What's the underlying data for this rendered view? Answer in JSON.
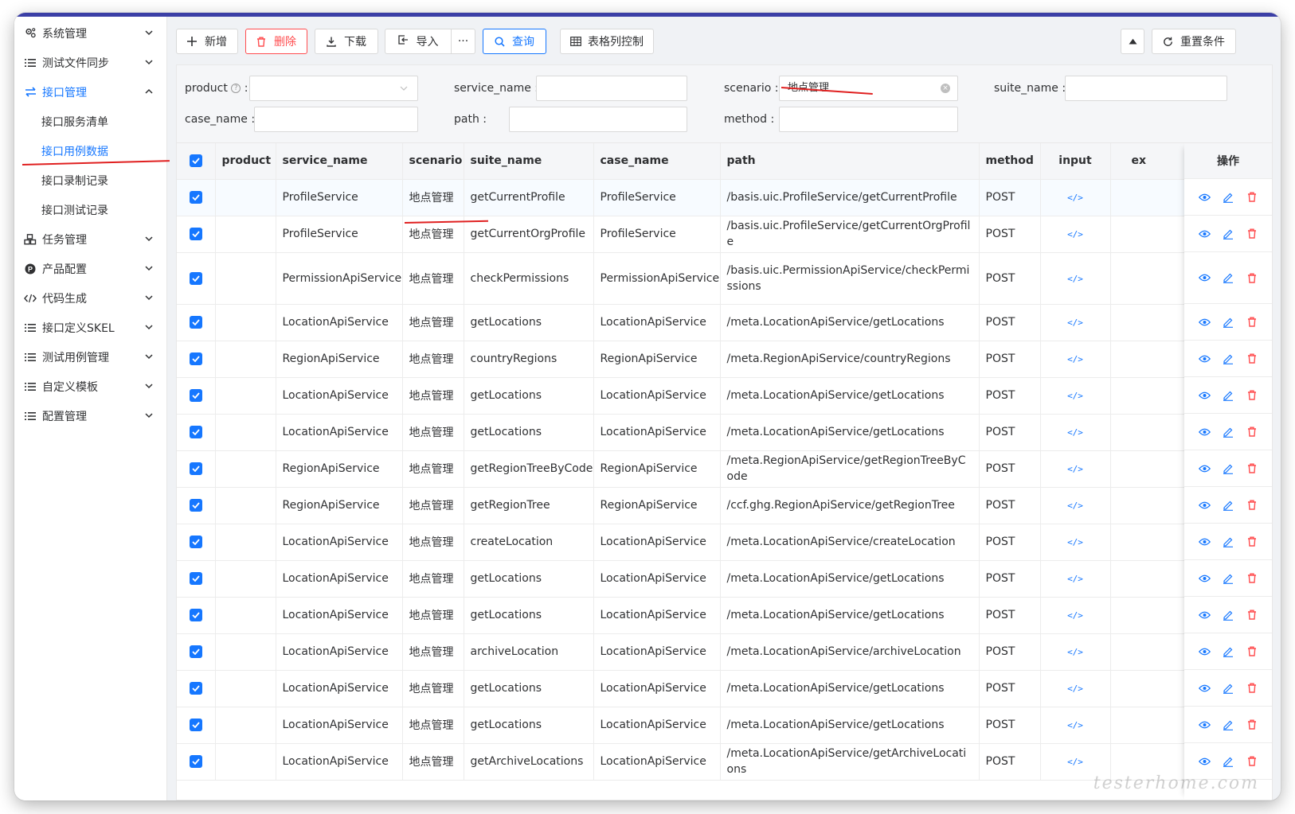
{
  "sidebar": {
    "menus": [
      {
        "label": "系统管理",
        "icon": "gears-icon",
        "expanded": false
      },
      {
        "label": "测试文件同步",
        "icon": "list-icon",
        "expanded": false
      },
      {
        "label": "接口管理",
        "icon": "swap-icon",
        "expanded": true,
        "children": [
          "接口服务清单",
          "接口用例数据",
          "接口录制记录",
          "接口测试记录"
        ],
        "selected_child": "接口用例数据"
      },
      {
        "label": "任务管理",
        "icon": "cubes-icon",
        "expanded": false
      },
      {
        "label": "产品配置",
        "icon": "product-icon",
        "expanded": false
      },
      {
        "label": "代码生成",
        "icon": "code-icon",
        "expanded": false
      },
      {
        "label": "接口定义SKEL",
        "icon": "list-icon",
        "expanded": false
      },
      {
        "label": "测试用例管理",
        "icon": "list-icon",
        "expanded": false
      },
      {
        "label": "自定义模板",
        "icon": "list-icon",
        "expanded": false
      },
      {
        "label": "配置管理",
        "icon": "list-icon",
        "expanded": false
      }
    ]
  },
  "toolbar": {
    "add_label": "新增",
    "delete_label": "删除",
    "download_label": "下载",
    "import_label": "导入",
    "more_label": "···",
    "query_label": "查询",
    "column_control_label": "表格列控制",
    "reset_label": "重置条件"
  },
  "filters": {
    "product_label": "product",
    "product_colon": ":",
    "service_name_label": "service_name :",
    "scenario_label": "scenario :",
    "scenario_value": "地点管理",
    "suite_name_label": "suite_name :",
    "case_name_label": "case_name :",
    "path_label": "path :",
    "method_label": "method :"
  },
  "table": {
    "columns": [
      "product",
      "service_name",
      "scenario",
      "suite_name",
      "case_name",
      "path",
      "method",
      "input",
      "ex"
    ],
    "ops_header": "操作",
    "rows": [
      {
        "product": "",
        "service_name": "ProfileService",
        "scenario": "地点管理",
        "suite_name": "getCurrentProfile",
        "case_name": "ProfileService",
        "path": "/basis.uic.ProfileService/getCurrentProfile",
        "method": "POST"
      },
      {
        "product": "",
        "service_name": "ProfileService",
        "scenario": "地点管理",
        "suite_name": "getCurrentOrgProfile",
        "case_name": "ProfileService",
        "path": "/basis.uic.ProfileService/getCurrentOrgProfile",
        "method": "POST"
      },
      {
        "product": "",
        "service_name": "PermissionApiService",
        "scenario": "地点管理",
        "suite_name": "checkPermissions",
        "case_name": "PermissionApiService",
        "path": "/basis.uic.PermissionApiService/checkPermissions",
        "method": "POST"
      },
      {
        "product": "",
        "service_name": "LocationApiService",
        "scenario": "地点管理",
        "suite_name": "getLocations",
        "case_name": "LocationApiService",
        "path": "/meta.LocationApiService/getLocations",
        "method": "POST"
      },
      {
        "product": "",
        "service_name": "RegionApiService",
        "scenario": "地点管理",
        "suite_name": "countryRegions",
        "case_name": "RegionApiService",
        "path": "/meta.RegionApiService/countryRegions",
        "method": "POST"
      },
      {
        "product": "",
        "service_name": "LocationApiService",
        "scenario": "地点管理",
        "suite_name": "getLocations",
        "case_name": "LocationApiService",
        "path": "/meta.LocationApiService/getLocations",
        "method": "POST"
      },
      {
        "product": "",
        "service_name": "LocationApiService",
        "scenario": "地点管理",
        "suite_name": "getLocations",
        "case_name": "LocationApiService",
        "path": "/meta.LocationApiService/getLocations",
        "method": "POST"
      },
      {
        "product": "",
        "service_name": "RegionApiService",
        "scenario": "地点管理",
        "suite_name": "getRegionTreeByCode",
        "case_name": "RegionApiService",
        "path": "/meta.RegionApiService/getRegionTreeByCode",
        "method": "POST"
      },
      {
        "product": "",
        "service_name": "RegionApiService",
        "scenario": "地点管理",
        "suite_name": "getRegionTree",
        "case_name": "RegionApiService",
        "path": "/ccf.ghg.RegionApiService/getRegionTree",
        "method": "POST"
      },
      {
        "product": "",
        "service_name": "LocationApiService",
        "scenario": "地点管理",
        "suite_name": "createLocation",
        "case_name": "LocationApiService",
        "path": "/meta.LocationApiService/createLocation",
        "method": "POST"
      },
      {
        "product": "",
        "service_name": "LocationApiService",
        "scenario": "地点管理",
        "suite_name": "getLocations",
        "case_name": "LocationApiService",
        "path": "/meta.LocationApiService/getLocations",
        "method": "POST"
      },
      {
        "product": "",
        "service_name": "LocationApiService",
        "scenario": "地点管理",
        "suite_name": "getLocations",
        "case_name": "LocationApiService",
        "path": "/meta.LocationApiService/getLocations",
        "method": "POST"
      },
      {
        "product": "",
        "service_name": "LocationApiService",
        "scenario": "地点管理",
        "suite_name": "archiveLocation",
        "case_name": "LocationApiService",
        "path": "/meta.LocationApiService/archiveLocation",
        "method": "POST"
      },
      {
        "product": "",
        "service_name": "LocationApiService",
        "scenario": "地点管理",
        "suite_name": "getLocations",
        "case_name": "LocationApiService",
        "path": "/meta.LocationApiService/getLocations",
        "method": "POST"
      },
      {
        "product": "",
        "service_name": "LocationApiService",
        "scenario": "地点管理",
        "suite_name": "getLocations",
        "case_name": "LocationApiService",
        "path": "/meta.LocationApiService/getLocations",
        "method": "POST"
      },
      {
        "product": "",
        "service_name": "LocationApiService",
        "scenario": "地点管理",
        "suite_name": "getArchiveLocations",
        "case_name": "LocationApiService",
        "path": "/meta.LocationApiService/getArchiveLocations",
        "method": "POST"
      }
    ]
  },
  "watermark": "testerhome.com",
  "colors": {
    "accent": "#1677ff",
    "danger": "#ff4d4f",
    "annotation": "#e02020",
    "topbar": "#3b3fa6"
  }
}
